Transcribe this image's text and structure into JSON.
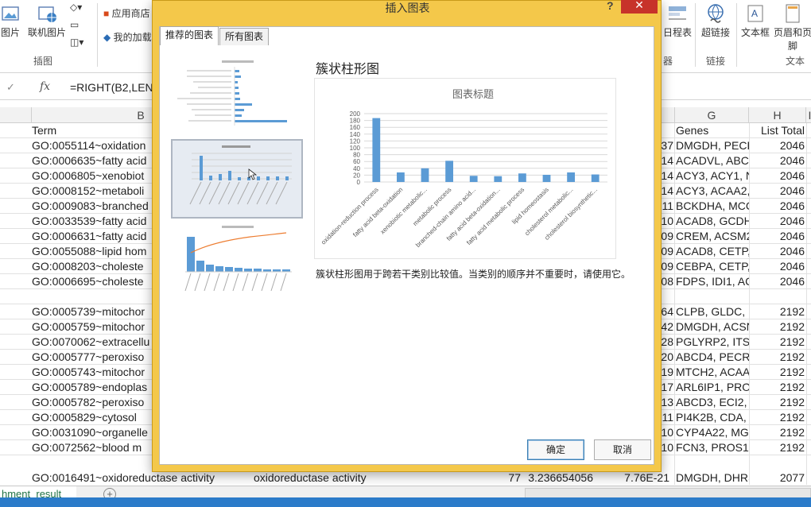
{
  "ribbon": {
    "buttons": [
      {
        "label": "图片"
      },
      {
        "label": "联机图片"
      },
      {
        "label": "应用商店"
      },
      {
        "label": "我的加载项"
      },
      {
        "label": "日程表"
      },
      {
        "label": "超链接"
      },
      {
        "label": "文本框"
      },
      {
        "label": "页眉和页脚"
      }
    ],
    "groups": {
      "illustrations": "插图",
      "filters": "器",
      "links": "链接",
      "text": "文本"
    }
  },
  "formula_bar": {
    "cancel_icon": "✓",
    "fx_label": "fx",
    "formula": "=RIGHT(B2,LEN"
  },
  "columns": {
    "B": "B",
    "G": "G",
    "H": "H",
    "I": "I"
  },
  "headers": {
    "term": "Term",
    "genes": "Genes",
    "list_total": "List Total"
  },
  "rows": [
    {
      "term": "GO:0055114~oxidation",
      "mid": "37",
      "genes": "DMGDH, PECR",
      "total": "2046"
    },
    {
      "term": "GO:0006635~fatty acid",
      "mid": "14",
      "genes": "ACADVL, ABCI",
      "total": "2046"
    },
    {
      "term": "GO:0006805~xenobiot",
      "mid": "14",
      "genes": "ACY3, ACY1, N",
      "total": "2046"
    },
    {
      "term": "GO:0008152~metaboli",
      "mid": "14",
      "genes": "ACY3, ACAA2,",
      "total": "2046"
    },
    {
      "term": "GO:0009083~branched",
      "mid": "11",
      "genes": "BCKDHA, MCC",
      "total": "2046"
    },
    {
      "term": "GO:0033539~fatty acid",
      "mid": "10",
      "genes": "ACAD8, GCDH",
      "total": "2046"
    },
    {
      "term": "GO:0006631~fatty acid",
      "mid": "09",
      "genes": "CREM, ACSM2",
      "total": "2046"
    },
    {
      "term": "GO:0055088~lipid hom",
      "mid": "09",
      "genes": "ACAD8, CETP,",
      "total": "2046"
    },
    {
      "term": "GO:0008203~choleste",
      "mid": "09",
      "genes": "CEBPA, CETP,",
      "total": "2046"
    },
    {
      "term": "GO:0006695~choleste",
      "mid": "08",
      "genes": "FDPS, IDI1, AC",
      "total": "2046"
    },
    {
      "term": "",
      "mid": "",
      "genes": "",
      "total": ""
    },
    {
      "term": "GO:0005739~mitochor",
      "mid": "64",
      "genes": "CLPB, GLDC, E",
      "total": "2192"
    },
    {
      "term": "GO:0005759~mitochor",
      "mid": "42",
      "genes": "DMGDH, ACSN",
      "total": "2192"
    },
    {
      "term": "GO:0070062~extracellu",
      "mid": "28",
      "genes": "PGLYRP2, ITSN",
      "total": "2192"
    },
    {
      "term": "GO:0005777~peroxiso",
      "mid": "20",
      "genes": "ABCD4, PECR,",
      "total": "2192"
    },
    {
      "term": "GO:0005743~mitochor",
      "mid": "19",
      "genes": "MTCH2, ACAA",
      "total": "2192"
    },
    {
      "term": "GO:0005789~endoplas",
      "mid": "17",
      "genes": "ARL6IP1, PROS",
      "total": "2192"
    },
    {
      "term": "GO:0005782~peroxiso",
      "mid": "13",
      "genes": "ABCD3, ECI2, I",
      "total": "2192"
    },
    {
      "term": "GO:0005829~cytosol",
      "mid": "11",
      "genes": "PI4K2B, CDA, C",
      "total": "2192"
    },
    {
      "term": "GO:0031090~organelle",
      "mid": "10",
      "genes": "CYP4A22, MGS",
      "total": "2192"
    },
    {
      "term": "GO:0072562~blood m",
      "mid": "10",
      "genes": "FCN3, PROS1,",
      "total": "2192"
    }
  ],
  "last_row": {
    "term": "GO:0016491~oxidoreductase activity",
    "c": "oxidoreductase activity",
    "d": "77",
    "e": "3.236654056",
    "f": "7.76E-21",
    "genes": "DMGDH, DHRS",
    "total": "2077"
  },
  "sheet": {
    "tab_label": "hment_result",
    "add_label": "+"
  },
  "dialog": {
    "title": "插入图表",
    "help": "?",
    "close": "✕",
    "tabs": [
      "推荐的图表",
      "所有图表"
    ],
    "preview_title": "簇状柱形图",
    "description": "簇状柱形图用于跨若干类别比较值。当类别的顺序并不重要时，请使用它。",
    "ok": "确定",
    "cancel": "取消"
  },
  "chart_data": {
    "type": "bar",
    "title": "图表标题",
    "categories": [
      "oxidation-reduction process",
      "fatty acid beta-oxidation",
      "xenobiotic metabolic...",
      "metabolic process",
      "branched-chain amino acid...",
      "fatty acid beta-oxidation...",
      "fatty acid metabolic process",
      "lipid homeostasis",
      "cholesterol metabolic...",
      "cholesterol biosynthetic..."
    ],
    "values": [
      187,
      28,
      40,
      62,
      18,
      17,
      25,
      21,
      28,
      22
    ],
    "ylim": [
      0,
      200
    ],
    "yticks": [
      0,
      20,
      40,
      60,
      80,
      100,
      120,
      140,
      160,
      180,
      200
    ],
    "bar_color": "#5b9bd5",
    "grid": true
  },
  "colors": {
    "dialog_frame": "#f4c84a",
    "close_button": "#c7332a",
    "excel_green": "#217346"
  }
}
